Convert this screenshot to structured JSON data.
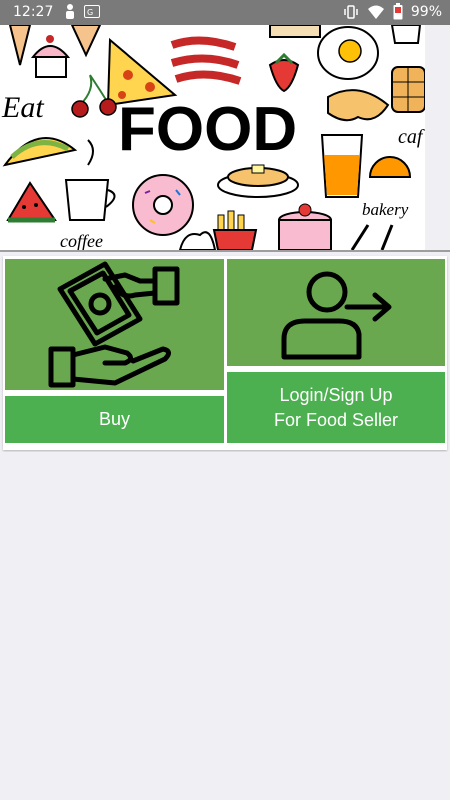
{
  "status_bar": {
    "time": "12:27",
    "battery": "99%",
    "icons": [
      "person-icon",
      "sim-card-icon",
      "vibrate-icon",
      "wifi-icon",
      "battery-icon"
    ]
  },
  "banner": {
    "words": [
      "Eat",
      "FOOD",
      "coffee",
      "bakery",
      "caf"
    ],
    "icons": [
      "ice-cream-cone",
      "cupcake",
      "pizza-slice",
      "bacon",
      "strawberry",
      "fried-egg",
      "waffle",
      "cherries",
      "croissant",
      "taco",
      "orange-juice",
      "orange-slice",
      "watermelon",
      "coffee-cup",
      "donut",
      "pancakes",
      "french-fries",
      "cake",
      "fork-and-knife"
    ]
  },
  "actions": {
    "buy_label": "Buy",
    "seller_label": "Login/Sign Up For Food Seller",
    "buy_icon": "hand-money-icon",
    "seller_icon": "person-arrow-icon"
  },
  "colors": {
    "tile_image_green": "#6aa84f",
    "tile_button_green": "#4caf50",
    "status_bar": "#7a7a7a",
    "background": "#efeff4"
  }
}
